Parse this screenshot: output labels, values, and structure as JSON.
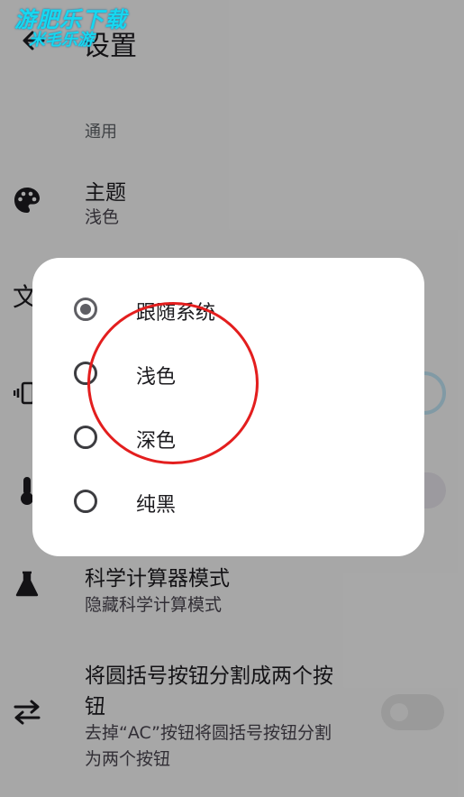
{
  "watermark": {
    "line1": "游肥乐下载",
    "line2": "米毛乐游"
  },
  "header": {
    "title": "设置"
  },
  "section": {
    "general": "通用"
  },
  "settings": {
    "theme": {
      "title": "主题",
      "value": "浅色"
    },
    "sci": {
      "title": "科学计算器模式",
      "subtitle": "隐藏科学计算模式"
    },
    "bracket": {
      "title_line1": "将圆括号按钮分割成两个按",
      "title_line2": "钮",
      "subtitle_line1": "去掉“AC”按钮将圆括号按钮分割",
      "subtitle_line2": "为两个按钮",
      "enabled": false
    }
  },
  "dialog": {
    "options": [
      {
        "label": "跟随系统",
        "selected": true
      },
      {
        "label": "浅色",
        "selected": false
      },
      {
        "label": "深色",
        "selected": false
      },
      {
        "label": "纯黑",
        "selected": false
      }
    ]
  },
  "colors": {
    "annotation": "#e31e1e",
    "scrim": "rgba(0,0,0,0.32)"
  }
}
